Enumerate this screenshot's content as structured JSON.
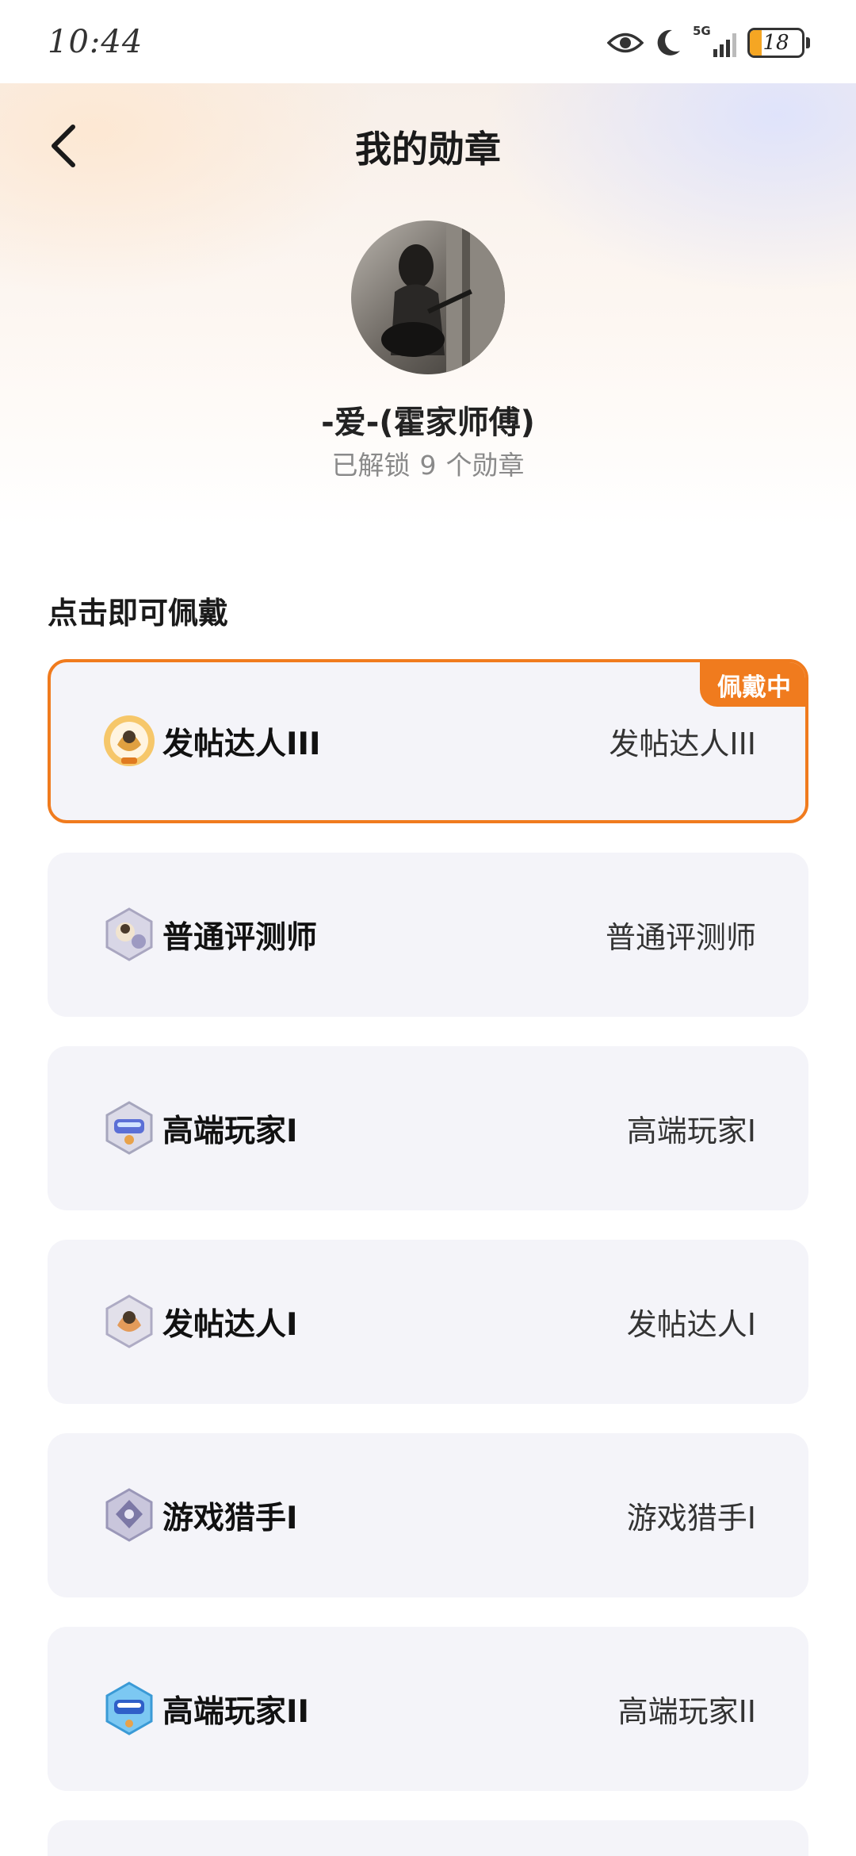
{
  "status_bar": {
    "time": "10:44",
    "network": "5G",
    "battery": "18"
  },
  "nav": {
    "title": "我的勋章",
    "back_icon": "chevron-left-icon"
  },
  "profile": {
    "name": "-爱-(霍家师傅)",
    "unlock_prefix": "已解锁",
    "unlock_count": "9",
    "unlock_suffix": "个勋章"
  },
  "section_title": "点击即可佩戴",
  "colors": {
    "accent": "#f07b1e",
    "card_bg": "#f4f4f9"
  },
  "badges": [
    {
      "name": "发帖达人III",
      "desc": "发帖达人III",
      "tag": "佩戴中",
      "icon": "badge-poster-gold-icon"
    },
    {
      "name": "普通评测师",
      "desc": "普通评测师",
      "icon": "badge-reviewer-icon"
    },
    {
      "name": "高端玩家I",
      "desc": "高端玩家I",
      "icon": "badge-pro-player-icon"
    },
    {
      "name": "发帖达人I",
      "desc": "发帖达人I",
      "icon": "badge-poster-icon"
    },
    {
      "name": "游戏猎手I",
      "desc": "游戏猎手I",
      "icon": "badge-game-hunter-icon"
    },
    {
      "name": "高端玩家II",
      "desc": "高端玩家II",
      "icon": "badge-pro-player-blue-icon"
    }
  ]
}
